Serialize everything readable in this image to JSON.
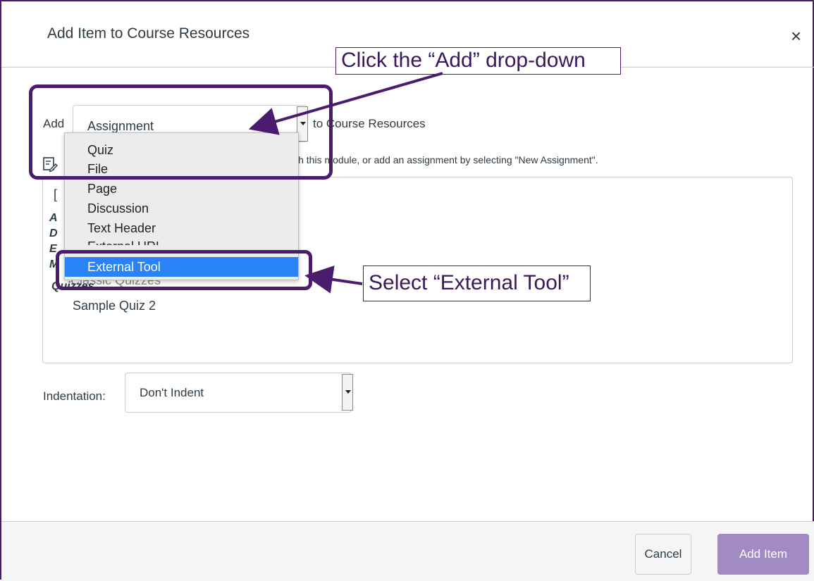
{
  "dialog": {
    "title": "Add Item to Course Resources",
    "close_glyph": "×"
  },
  "add_row": {
    "label": "Add",
    "selected": "Assignment",
    "suffix": "to Course Resources"
  },
  "instructions": "with this module, or add an assignment by selecting \"New Assignment\".",
  "dropdown": {
    "items": [
      "Quiz",
      "File",
      "Page",
      "Discussion",
      "Text Header",
      "External URL",
      "External Tool"
    ],
    "selected": "External Tool"
  },
  "list": {
    "partial_fragments": [
      "[",
      "A",
      "D",
      "E",
      "M",
      "Quizzes"
    ],
    "overlap_text": "Classic Quizzes",
    "items": [
      "Sample Quiz 2"
    ]
  },
  "indentation": {
    "label": "Indentation:",
    "value": "Don't Indent"
  },
  "footer": {
    "cancel": "Cancel",
    "add_item": "Add Item"
  },
  "annotations": {
    "callout_add": "Click the “Add” drop-down",
    "callout_tool": "Select “External Tool”"
  },
  "colors": {
    "annotation": "#4b1b6e",
    "selected_highlight": "#2a83f6",
    "primary_button": "#a18bc2"
  }
}
